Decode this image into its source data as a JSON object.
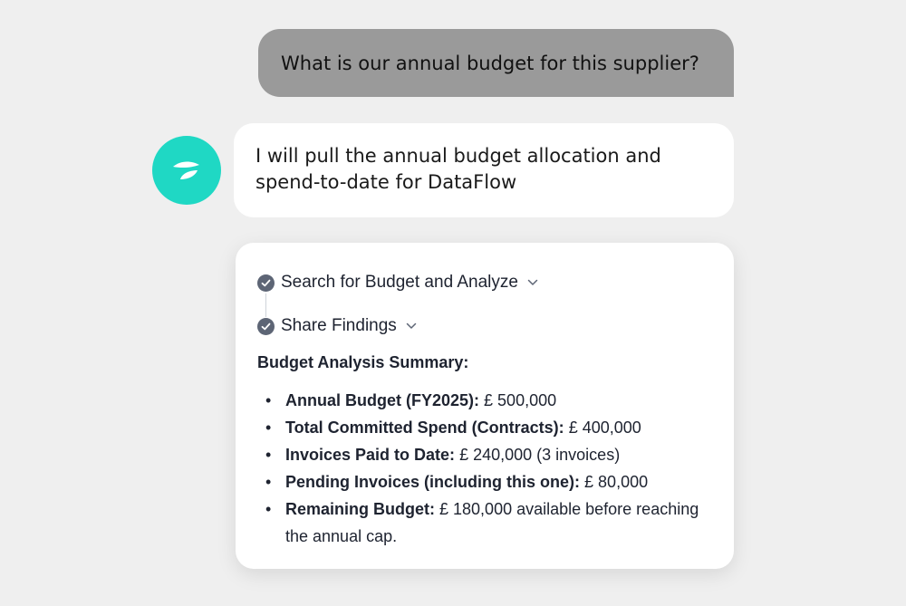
{
  "conversation": {
    "user_message": "What is our annual budget for this supplier?",
    "assistant_message": "I will pull the annual budget allocation and spend-to-date for DataFlow",
    "assistant_message_line1": "I will pull the annual budget allocation and",
    "assistant_message_line2": "spend-to-date for DataFlow"
  },
  "colors": {
    "avatar": "#1fd8c4",
    "user_bubble": "#9a9a9a",
    "background": "#efefef",
    "check": "#5d6575"
  },
  "steps": [
    {
      "label": "Search for Budget and Analyze",
      "status": "complete",
      "icon": "check-circle-icon"
    },
    {
      "label": "Share Findings",
      "status": "complete",
      "icon": "check-circle-icon"
    }
  ],
  "summary": {
    "title": "Budget Analysis Summary:",
    "items": [
      {
        "label": "Annual Budget (FY2025):",
        "value": "£ 500,000"
      },
      {
        "label": "Total Committed Spend (Contracts):",
        "value": "£ 400,000"
      },
      {
        "label": "Invoices Paid to Date:",
        "value": "£ 240,000 (3 invoices)"
      },
      {
        "label": "Pending Invoices (including this one):",
        "value": "£ 80,000"
      },
      {
        "label": "Remaining Budget:",
        "value": "£ 180,000 available before reaching the annual cap."
      }
    ]
  }
}
